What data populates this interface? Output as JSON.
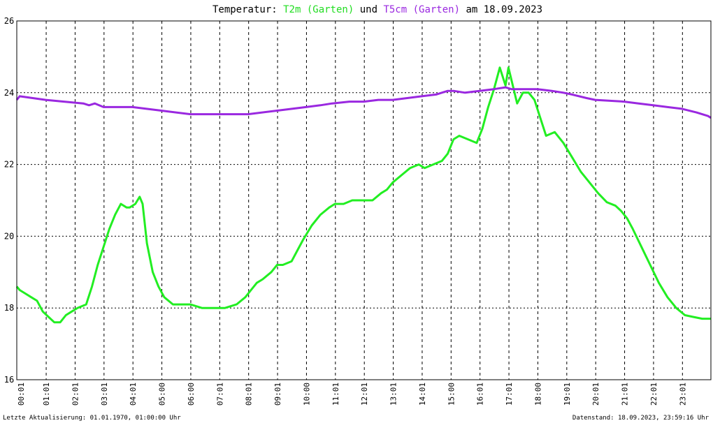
{
  "chart_data": {
    "type": "line",
    "title": {
      "prefix": "Temperatur: ",
      "series1": "T2m (Garten)",
      "mid": " und ",
      "series2": "T5cm (Garten)",
      "suffix": " am 18.09.2023"
    },
    "ylim": [
      16,
      26
    ],
    "yticks": [
      16,
      18,
      20,
      22,
      24,
      26
    ],
    "xlim": [
      0,
      24
    ],
    "xticks": [
      "00:01",
      "01:01",
      "02:01",
      "03:01",
      "04:01",
      "05:00",
      "06:00",
      "07:01",
      "08:01",
      "09:01",
      "10:00",
      "11:01",
      "12:01",
      "13:01",
      "14:01",
      "15:00",
      "16:01",
      "17:01",
      "18:00",
      "19:01",
      "20:01",
      "21:01",
      "22:01",
      "23:01"
    ],
    "grid": true,
    "series": [
      {
        "name": "T2m (Garten)",
        "color": "#22ee22",
        "x": [
          0.0,
          0.1,
          0.3,
          0.5,
          0.7,
          0.9,
          1.1,
          1.3,
          1.5,
          1.7,
          1.9,
          2.1,
          2.4,
          2.6,
          2.8,
          3.0,
          3.2,
          3.4,
          3.6,
          3.8,
          3.9,
          4.1,
          4.25,
          4.35,
          4.5,
          4.7,
          4.9,
          5.1,
          5.4,
          5.7,
          6.0,
          6.4,
          6.8,
          7.2,
          7.6,
          7.9,
          8.1,
          8.3,
          8.5,
          8.8,
          9.0,
          9.2,
          9.5,
          9.7,
          9.9,
          10.2,
          10.5,
          10.8,
          11.0,
          11.3,
          11.6,
          12.0,
          12.3,
          12.6,
          12.8,
          13.0,
          13.3,
          13.6,
          13.9,
          14.1,
          14.4,
          14.7,
          14.9,
          15.1,
          15.3,
          15.6,
          15.9,
          16.1,
          16.3,
          16.5,
          16.7,
          16.9,
          17.0,
          17.15,
          17.3,
          17.5,
          17.7,
          17.9,
          18.1,
          18.3,
          18.6,
          18.9,
          19.2,
          19.5,
          19.8,
          20.1,
          20.4,
          20.7,
          20.9,
          21.1,
          21.3,
          21.6,
          21.9,
          22.2,
          22.5,
          22.8,
          23.1,
          23.4,
          23.7,
          24.0
        ],
        "y": [
          18.6,
          18.5,
          18.4,
          18.3,
          18.2,
          17.9,
          17.75,
          17.6,
          17.6,
          17.8,
          17.9,
          18.0,
          18.1,
          18.6,
          19.2,
          19.7,
          20.2,
          20.6,
          20.9,
          20.8,
          20.8,
          20.9,
          21.1,
          20.9,
          19.8,
          19.0,
          18.6,
          18.3,
          18.1,
          18.1,
          18.1,
          18.0,
          18.0,
          18.0,
          18.1,
          18.3,
          18.5,
          18.7,
          18.8,
          19.0,
          19.2,
          19.2,
          19.3,
          19.6,
          19.9,
          20.3,
          20.6,
          20.8,
          20.9,
          20.9,
          21.0,
          21.0,
          21.0,
          21.2,
          21.3,
          21.5,
          21.7,
          21.9,
          22.0,
          21.9,
          22.0,
          22.1,
          22.3,
          22.7,
          22.8,
          22.7,
          22.6,
          23.0,
          23.6,
          24.1,
          24.7,
          24.2,
          24.7,
          24.2,
          23.7,
          24.0,
          24.0,
          23.8,
          23.3,
          22.8,
          22.9,
          22.6,
          22.2,
          21.8,
          21.5,
          21.2,
          20.95,
          20.85,
          20.7,
          20.5,
          20.2,
          19.7,
          19.2,
          18.7,
          18.3,
          18.0,
          17.8,
          17.75,
          17.7,
          17.7
        ]
      },
      {
        "name": "T5cm (Garten)",
        "color": "#9a28e0",
        "x": [
          0.0,
          0.1,
          1.0,
          2.3,
          2.5,
          2.7,
          3.0,
          4.0,
          5.0,
          6.0,
          7.0,
          8.0,
          9.0,
          10.0,
          10.5,
          10.9,
          11.5,
          12.0,
          12.5,
          13.0,
          13.5,
          14.0,
          14.5,
          14.9,
          15.1,
          15.5,
          16.0,
          16.5,
          16.9,
          17.1,
          17.5,
          18.0,
          18.5,
          18.9,
          19.2,
          19.7,
          20.0,
          21.0,
          21.5,
          22.0,
          22.5,
          23.0,
          23.5,
          23.9,
          24.0
        ],
        "y": [
          23.8,
          23.9,
          23.8,
          23.7,
          23.65,
          23.7,
          23.6,
          23.6,
          23.5,
          23.4,
          23.4,
          23.4,
          23.5,
          23.6,
          23.65,
          23.7,
          23.75,
          23.75,
          23.8,
          23.8,
          23.85,
          23.9,
          23.95,
          24.05,
          24.05,
          24.0,
          24.05,
          24.1,
          24.15,
          24.1,
          24.1,
          24.1,
          24.05,
          24.0,
          23.95,
          23.85,
          23.8,
          23.75,
          23.7,
          23.65,
          23.6,
          23.55,
          23.45,
          23.35,
          23.3
        ]
      }
    ]
  },
  "footer": {
    "left": "Letzte Aktualisierung: 01.01.1970, 01:00:00 Uhr",
    "right": "Datenstand: 18.09.2023, 23:59:16 Uhr"
  }
}
